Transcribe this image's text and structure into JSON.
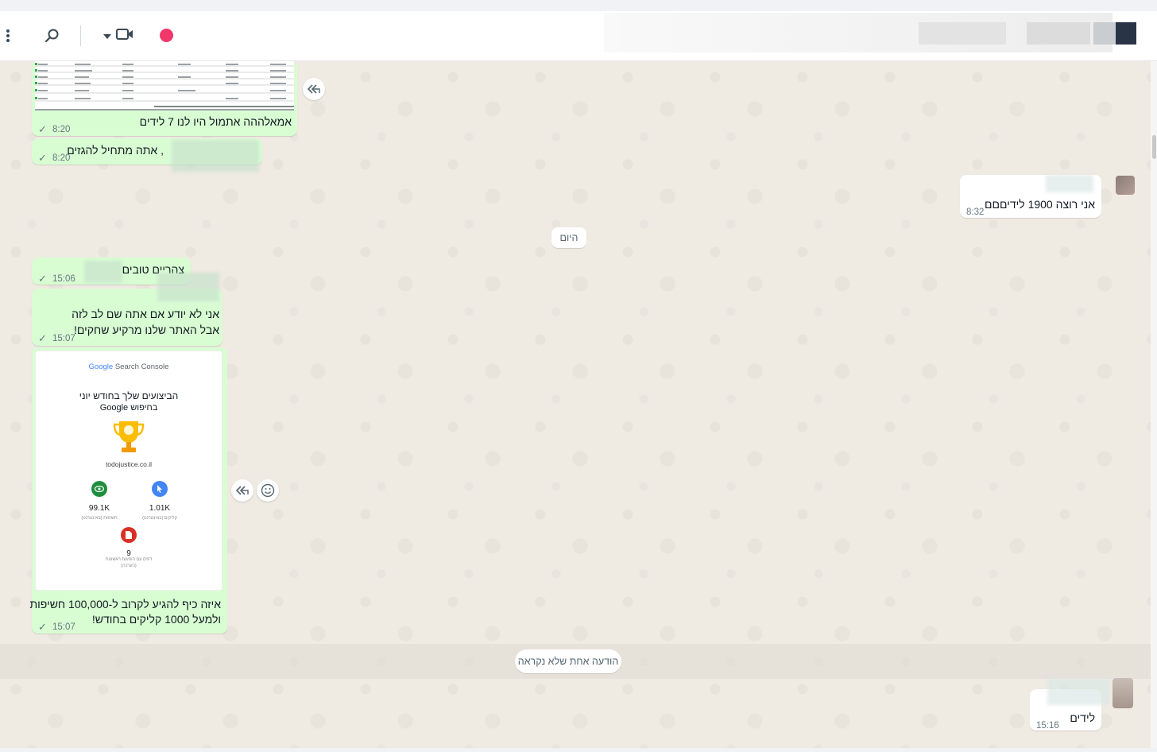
{
  "chat": {
    "messages": [
      {
        "text": "אמאלההה אתמול היו לנו 7 לידים",
        "time": "8:20"
      },
      {
        "text": ", אתה מתחיל להגזים",
        "time": "8:20"
      },
      {
        "text": "אני רוצה 1900 לידיםםם",
        "time": "8:32"
      },
      {
        "text": "צהריים טובים",
        "time": "15:06"
      },
      {
        "line1": "אני לא יודע אם אתה שם לב לזה",
        "line2": "אבל האתר שלנו מרקיע שחקים!",
        "time": "15:07"
      },
      {
        "line1": "איזה כיף להגיע לקרוב ל-100,000 חשיפות",
        "line2": "ולמעל 1000 קליקים בחודש!",
        "time": "15:07"
      },
      {
        "text": "לידים",
        "time": "15:16"
      }
    ],
    "date_divider": "היום",
    "unread_divider": "הודעה אחת שלא נקראה"
  },
  "gsc_card": {
    "brand_google": "Google",
    "brand_product": "Search Console",
    "title_line1": "הביצועים שלך בחודש יוני",
    "title_line2": "בחיפוש Google",
    "domain": "todojustice.co.il",
    "stats": [
      {
        "value": "99.1K",
        "label": "חשיפות (באינטרנט)",
        "color": "#1e8e3e",
        "icon": "eye-icon"
      },
      {
        "value": "1.01K",
        "label": "קליקים (באינטרנט)",
        "color": "#4285f4",
        "icon": "cursor-icon"
      },
      {
        "value": "9",
        "label": "דפים עם הופעות ראשונות (הערכה)",
        "color": "#d93025",
        "icon": "page-icon"
      }
    ]
  },
  "colors": {
    "outgoing_bubble": "#d9fdd3",
    "incoming_bubble": "#ffffff",
    "record_dot": "#f0386b",
    "chat_background": "#efeae2"
  },
  "header_icons": [
    "menu-dots-icon",
    "search-icon",
    "video-call-icon",
    "chevron-down-icon",
    "record-dot"
  ]
}
